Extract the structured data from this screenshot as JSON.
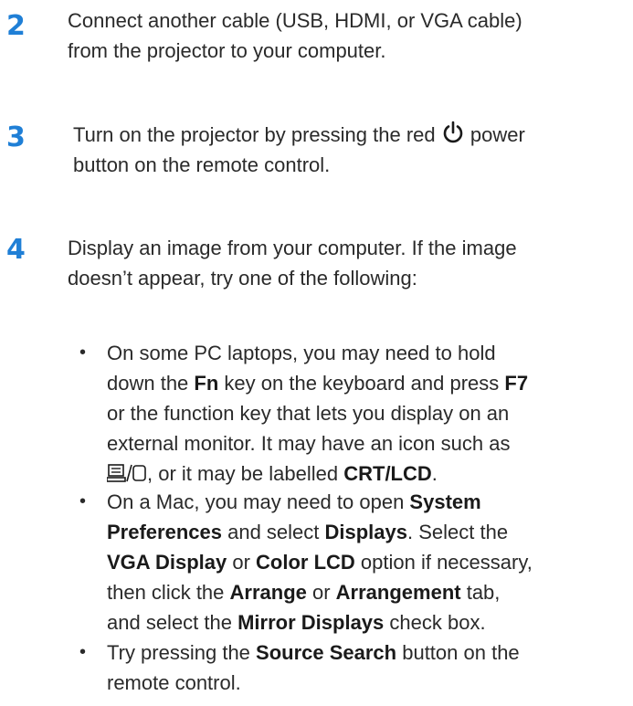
{
  "step2": {
    "number": "2",
    "line1": "Connect another cable (USB, HDMI, or VGA cable)",
    "line2": "from the projector to your computer."
  },
  "step3": {
    "number": "3",
    "line1_pre": "Turn on the projector by pressing the red",
    "line1_post": "power",
    "line2": "button on the remote control.",
    "icon": "power-icon"
  },
  "step4": {
    "number": "4",
    "line1": "Display an image from your computer. If the image",
    "line2": "doesn’t appear, try one of the following:"
  },
  "bullets": [
    {
      "lines": [
        [
          "On some PC laptops, you may need to hold"
        ],
        [
          "down the ",
          {
            "b": "Fn"
          },
          " key on the keyboard and press ",
          {
            "b": "F7"
          }
        ],
        [
          "or the function key that lets you display on an"
        ],
        [
          "external monitor. It may have an icon such as"
        ],
        [
          {
            "icon": "display-switch-icon"
          },
          ", or it may be labelled ",
          {
            "b": "CRT/LCD"
          },
          "."
        ]
      ]
    },
    {
      "lines": [
        [
          "On a Mac, you may need to open ",
          {
            "b": "System"
          }
        ],
        [
          {
            "b": "Preferences"
          },
          " and select ",
          {
            "b": "Displays"
          },
          ". Select the"
        ],
        [
          {
            "b": "VGA Display"
          },
          " or ",
          {
            "b": "Color LCD"
          },
          " option if necessary,"
        ],
        [
          "then click the ",
          {
            "b": "Arrange"
          },
          " or ",
          {
            "b": "Arrangement"
          },
          " tab,"
        ],
        [
          "and select the ",
          {
            "b": "Mirror Displays"
          },
          " check box."
        ]
      ]
    },
    {
      "lines": [
        [
          "Try pressing the ",
          {
            "b": "Source Search"
          },
          " button on the"
        ],
        [
          "remote control."
        ]
      ]
    }
  ],
  "bullet_char": "•",
  "colors": {
    "step_number": "#1f7fd6",
    "text": "#2a2a2a"
  }
}
